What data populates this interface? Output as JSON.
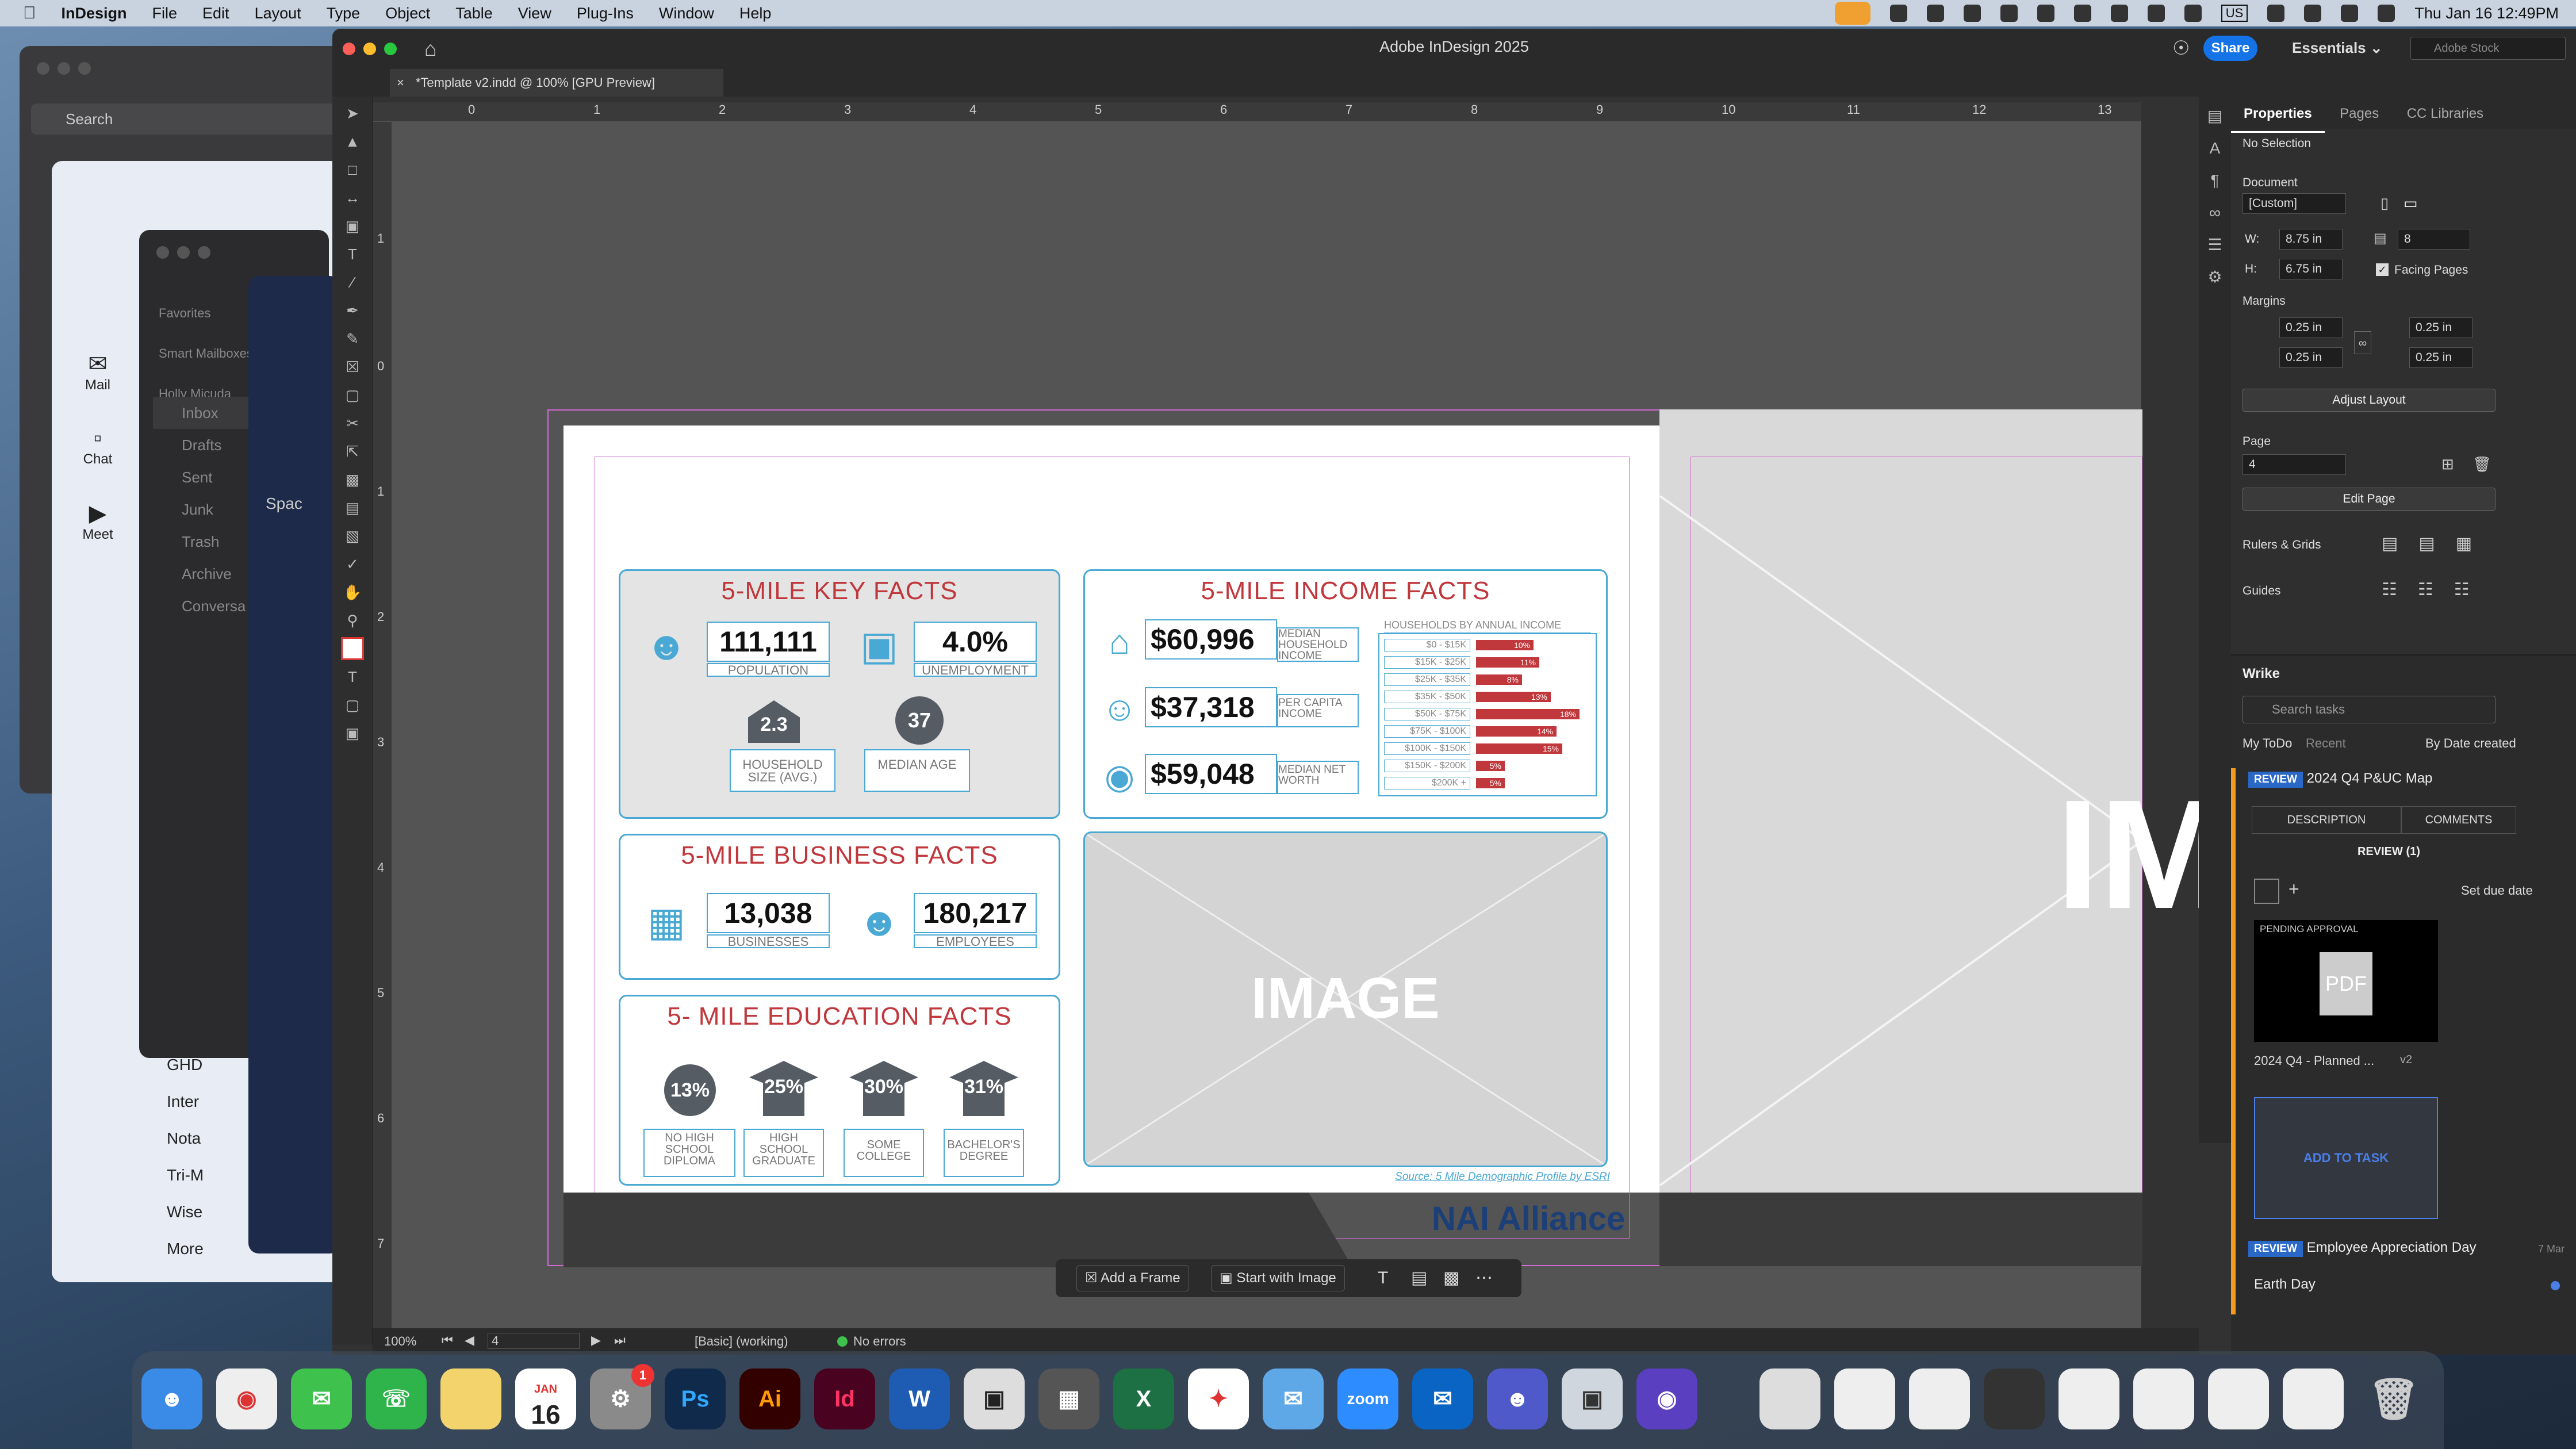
{
  "menubar": {
    "app": "InDesign",
    "items": [
      "File",
      "Edit",
      "Layout",
      "Type",
      "Object",
      "Table",
      "View",
      "Plug-Ins",
      "Window",
      "Help"
    ],
    "input_source": "US",
    "datetime": "Thu Jan 16  12:49PM"
  },
  "bg_windows": {
    "finder_search": "Search",
    "gmail": {
      "mail": "Mail",
      "chat": "Chat",
      "meet": "Meet"
    },
    "mail_sidebar": {
      "favorites": "Favorites",
      "smart": "Smart Mailboxes",
      "account": "Holly Micuda",
      "items": [
        "Inbox",
        "Drafts",
        "Sent",
        "Junk",
        "Trash",
        "Archive",
        "Conversa"
      ]
    },
    "notes_items": [
      "GHD",
      "Inter",
      "Nota",
      "Tri-M",
      "Wise"
    ],
    "notes_more": "More",
    "wrike_peek": "Spac"
  },
  "indesign": {
    "window_title": "Adobe InDesign 2025",
    "share": "Share",
    "workspace": "Essentials",
    "stock_search": "Adobe Stock",
    "doc_tab": "*Template v2.indd @ 100% [GPU Preview]",
    "ruler_h": [
      "0",
      "1",
      "2",
      "3",
      "4",
      "5",
      "6",
      "7",
      "8",
      "9",
      "10",
      "11",
      "12",
      "13"
    ],
    "ruler_v": [
      "1",
      "0",
      "1",
      "2",
      "3",
      "4",
      "5",
      "6",
      "7"
    ],
    "float_bar": {
      "add_frame": "Add a Frame",
      "start_image": "Start with Image"
    },
    "status": {
      "zoom": "100%",
      "page": "4",
      "style": "[Basic] (working)",
      "errors": "No errors"
    }
  },
  "layout": {
    "key_facts": {
      "title": "5-MILE KEY FACTS",
      "population": "111,111",
      "population_label": "POPULATION",
      "unemployment": "4.0%",
      "unemployment_label": "UNEMPLOYMENT",
      "household_size": "2.3",
      "household_size_label": "HOUSEHOLD SIZE (AVG.)",
      "median_age": "37",
      "median_age_label": "MEDIAN AGE"
    },
    "income_facts": {
      "title": "5-MILE INCOME FACTS",
      "median_income": "$60,996",
      "median_income_label": "MEDIAN HOUSEHOLD INCOME",
      "per_capita": "$37,318",
      "per_capita_label": "PER CAPITA INCOME",
      "net_worth": "$59,048",
      "net_worth_label": "MEDIAN NET WORTH",
      "hh_title": "HOUSEHOLDS BY ANNUAL INCOME",
      "hh_rows": [
        {
          "label": "$0 - $15K",
          "pct": "10%",
          "value": 10
        },
        {
          "label": "$15K - $25K",
          "pct": "11%",
          "value": 11
        },
        {
          "label": "$25K - $35K",
          "pct": "8%",
          "value": 8
        },
        {
          "label": "$35K - $50K",
          "pct": "13%",
          "value": 13
        },
        {
          "label": "$50K - $75K",
          "pct": "18%",
          "value": 18
        },
        {
          "label": "$75K - $100K",
          "pct": "14%",
          "value": 14
        },
        {
          "label": "$100K - $150K",
          "pct": "15%",
          "value": 15
        },
        {
          "label": "$150K - $200K",
          "pct": "5%",
          "value": 5
        },
        {
          "label": "$200K +",
          "pct": "5%",
          "value": 5
        }
      ]
    },
    "business_facts": {
      "title": "5-MILE BUSINESS FACTS",
      "businesses": "13,038",
      "businesses_label": "BUSINESSES",
      "employees": "180,217",
      "employees_label": "EMPLOYEES"
    },
    "education_facts": {
      "title": "5- MILE EDUCATION FACTS",
      "items": [
        {
          "pct": "13%",
          "label": "NO HIGH SCHOOL DIPLOMA"
        },
        {
          "pct": "25%",
          "label": "HIGH SCHOOL GRADUATE"
        },
        {
          "pct": "30%",
          "label": "SOME COLLEGE"
        },
        {
          "pct": "31%",
          "label": "BACHELOR'S DEGREE"
        }
      ]
    },
    "image_placeholder": "IMAGE",
    "right_image_placeholder": "IMA",
    "source": "Source: 5 Mile Demographic Profile by ESRI",
    "logo": "NAI Alliance"
  },
  "properties_panel": {
    "tabs": [
      "Properties",
      "Pages",
      "CC Libraries"
    ],
    "selection": "No Selection",
    "document_label": "Document",
    "preset": "[Custom]",
    "w_label": "W:",
    "w": "8.75 in",
    "h_label": "H:",
    "h": "6.75 in",
    "pages": "8",
    "facing_pages": "Facing Pages",
    "margins_label": "Margins",
    "margins": [
      "0.25 in",
      "0.25 in",
      "0.25 in",
      "0.25 in"
    ],
    "adjust_layout": "Adjust Layout",
    "page_label": "Page",
    "page": "4",
    "edit_page": "Edit Page",
    "rulers_grids": "Rulers & Grids",
    "guides": "Guides"
  },
  "wrike": {
    "title": "Wrike",
    "search_placeholder": "Search tasks",
    "tabs": [
      "My ToDo",
      "Recent"
    ],
    "sort": "By Date created",
    "task1": {
      "badge": "REVIEW",
      "title": "2024 Q4 P&UC Map",
      "description": "DESCRIPTION",
      "comments": "COMMENTS",
      "review": "REVIEW (1)",
      "due": "Set due date",
      "pending": "PENDING APPROVAL",
      "file_type": "PDF",
      "file_name": "2024 Q4 - Planned ...",
      "version": "v2"
    },
    "add_to_task": "ADD TO TASK",
    "task2": {
      "badge": "REVIEW",
      "title": "Employee Appreciation Day",
      "date": "7 Mar"
    },
    "task3": {
      "title": "Earth Day"
    }
  },
  "dock": {
    "calendar_month": "JAN",
    "calendar_day": "16",
    "badge": "1",
    "labels": [
      "Ps",
      "Ai",
      "Id",
      "W",
      "X",
      "zoom"
    ]
  }
}
